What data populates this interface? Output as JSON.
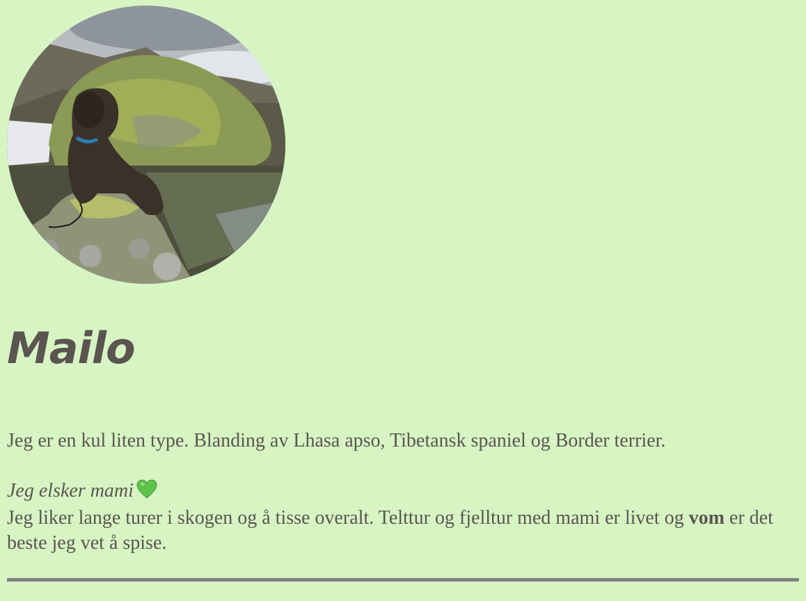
{
  "profile": {
    "name": "Mailo",
    "intro": "Jeg er en kul liten type. Blanding av Lhasa apso, Tibetansk spaniel og Border terrier.",
    "love_text": "Jeg elsker mami",
    "heart_icon": "green-heart-icon",
    "likes_part1": "Jeg liker lange turer i skogen og å tisse overalt. Telttur og fjelltur med mami er livet og",
    "likes_bold": "vom",
    "likes_part2": "er det beste jeg vet å spise."
  },
  "colors": {
    "background": "#d6f5c3",
    "text": "#5a5550",
    "divider": "#808080",
    "heart": "#5ec34a"
  }
}
